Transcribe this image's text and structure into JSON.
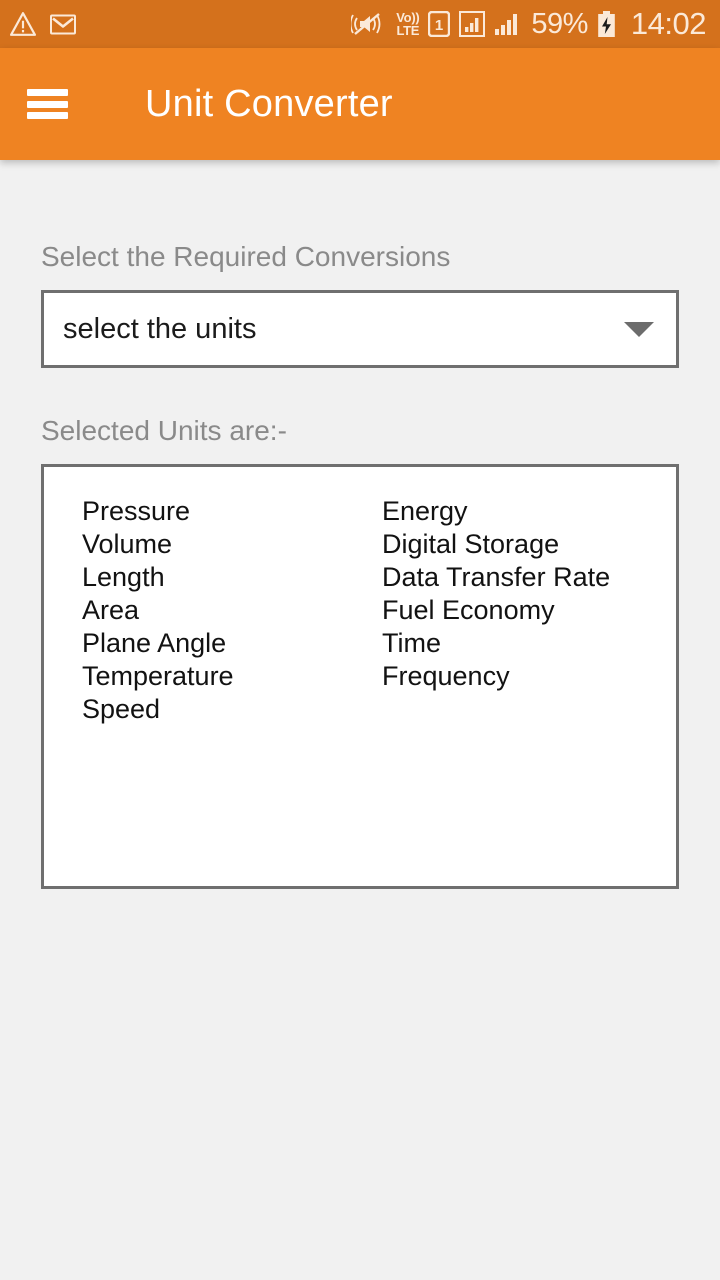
{
  "status_bar": {
    "background_color": "#d4711c",
    "icons_left": [
      "warning-icon",
      "gmail-icon"
    ],
    "icons_right": [
      "vibrate-mute-icon",
      "volte-icon",
      "sim-1-icon",
      "signal-sim2-icon",
      "signal-sim1-icon"
    ],
    "volte_line1": "Vo))",
    "volte_line2": "LTE",
    "sim_label": "1",
    "battery_percent": "59%",
    "battery_state": "charging",
    "time": "14:02"
  },
  "app_bar": {
    "background_color": "#ef8322",
    "menu_icon": "hamburger-menu-icon",
    "title": "Unit Converter"
  },
  "main": {
    "conversions_label": "Select the Required Conversions",
    "spinner": {
      "value": "select the units",
      "arrow_icon": "chevron-down-icon"
    },
    "selected_label": "Selected  Units are:-",
    "selected_units_left": [
      "Pressure",
      "Volume",
      "Length",
      "Area",
      "Plane Angle",
      "Temperature",
      "Speed"
    ],
    "selected_units_right": [
      "Energy",
      "Digital Storage",
      "Data Transfer Rate",
      "Fuel Economy",
      "Time",
      "Frequency"
    ]
  }
}
